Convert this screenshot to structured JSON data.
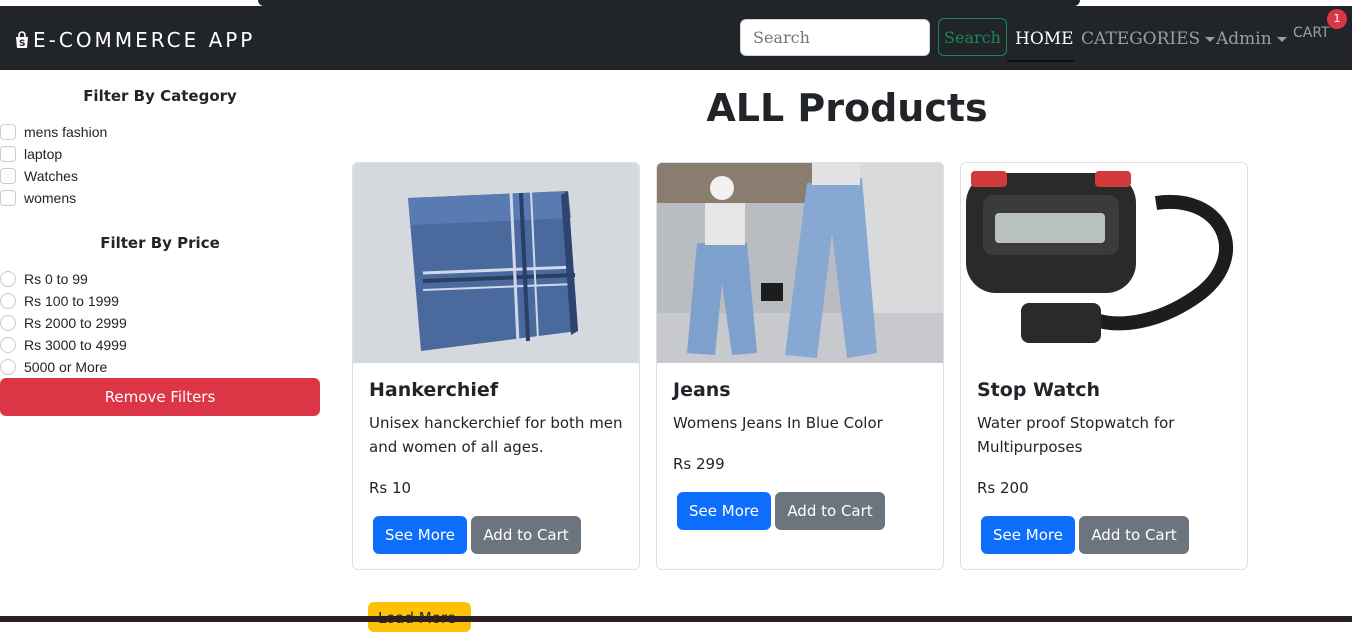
{
  "app": {
    "brand": "E-COMMERCE APP"
  },
  "header": {
    "search_placeholder": "Search",
    "search_button": "Search",
    "nav": {
      "home": "HOME",
      "categories": "CATEGORIES",
      "admin": "Admin",
      "cart": "CART",
      "cart_count": "1"
    }
  },
  "sidebar": {
    "category_title": "Filter By Category",
    "categories": [
      "mens fashion",
      "laptop",
      "Watches",
      "womens"
    ],
    "price_title": "Filter By Price",
    "prices": [
      "Rs 0 to 99",
      "Rs 100 to 1999",
      "Rs 2000 to 2999",
      "Rs 3000 to 4999",
      "5000 or More"
    ],
    "remove_button": "Remove Filters"
  },
  "main": {
    "title": "ALL Products",
    "products": [
      {
        "name": "Hankerchief",
        "description": "Unisex hanckerchief for both men and women of all ages.",
        "price": "Rs 10",
        "see_more": "See More",
        "add_to_cart": "Add to Cart"
      },
      {
        "name": "Jeans",
        "description": "Womens Jeans In Blue Color",
        "price": "Rs 299",
        "see_more": "See More",
        "add_to_cart": "Add to Cart"
      },
      {
        "name": "Stop Watch",
        "description": "Water proof Stopwatch for Multipurposes",
        "price": "Rs 200",
        "see_more": "See More",
        "add_to_cart": "Add to Cart"
      }
    ],
    "load_more": "Load More"
  },
  "colors": {
    "navbar": "#212529",
    "primary": "#0d6efd",
    "secondary": "#6c757d",
    "danger": "#dc3545",
    "success": "#198754",
    "warning": "#ffc107"
  }
}
